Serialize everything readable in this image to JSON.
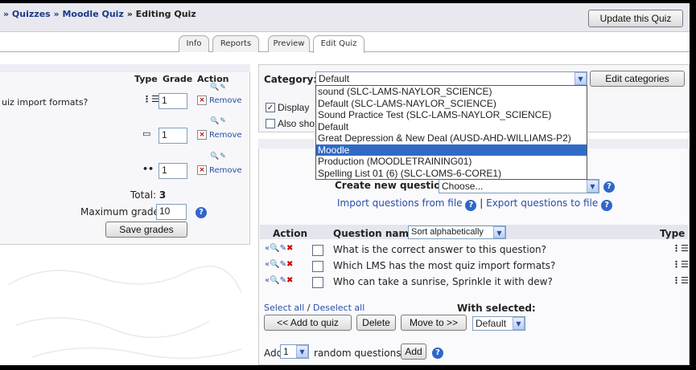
{
  "navbar": {
    "breadcrumb_quizzes": "» Quizzes",
    "breadcrumb_quiz": "» Moodle Quiz",
    "breadcrumb_current": "» Editing Quiz",
    "update_button": "Update this Quiz"
  },
  "tabs": [
    {
      "label": "Info"
    },
    {
      "label": "Reports"
    },
    {
      "label": "Preview"
    },
    {
      "label": "Edit Quiz"
    }
  ],
  "left": {
    "col_type": "Type",
    "col_grade": "Grade",
    "col_action": "Action",
    "rows": [
      {
        "text": "uiz import formats?",
        "grade": "1",
        "remove": "Remove"
      },
      {
        "text": "",
        "grade": "1",
        "remove": "Remove"
      },
      {
        "text": "",
        "grade": "1",
        "remove": "Remove"
      }
    ],
    "total_label": "Total:",
    "total_value": "3",
    "max_grade_label": "Maximum grade:",
    "max_grade_value": "10",
    "save_grades": "Save grades"
  },
  "category": {
    "label": "Category:",
    "selected": "Default",
    "edit_button": "Edit categories",
    "options": [
      {
        "label": "sound (SLC-LAMS-NAYLOR_SCIENCE)"
      },
      {
        "label": "Default (SLC-LAMS-NAYLOR_SCIENCE)"
      },
      {
        "label": "Sound Practice Test (SLC-LAMS-NAYLOR_SCIENCE)"
      },
      {
        "label": "Default"
      },
      {
        "label": "Great Depression & New Deal (AUSD-AHD-WILLIAMS-P2)"
      },
      {
        "label": "Moodle"
      },
      {
        "label": "Production (MOODLETRAINING01)"
      },
      {
        "label": "Spelling List 01 (6) (SLC-LOMS-6-CORE1)"
      }
    ],
    "highlighted_option": "Moodle",
    "display_checkbox_label": "Display",
    "also_checkbox_label": "Also sho"
  },
  "create": {
    "label": "Create new question:",
    "select_value": "Choose...",
    "import_link": "Import questions from file",
    "separator": "|",
    "export_link": "Export questions to file"
  },
  "question_table": {
    "col_action": "Action",
    "col_name": "Question name",
    "sort_value": "Sort alphabetically",
    "col_type": "Type",
    "rows": [
      {
        "name": "What is the correct answer to this question?"
      },
      {
        "name": "Which LMS has the most quiz import formats?"
      },
      {
        "name": "Who can take a sunrise, Sprinkle it with dew?"
      }
    ]
  },
  "bulk": {
    "select_all": "Select all",
    "slash": " / ",
    "deselect_all": "Deselect all",
    "with_selected": "With selected:",
    "add_to_quiz": "<< Add to quiz",
    "delete": "Delete",
    "move_to": "Move to >>",
    "move_target": "Default"
  },
  "random": {
    "add_label": "Add",
    "count": "1",
    "suffix": "random questions",
    "add_button": "Add"
  },
  "icons": {
    "help": "help-icon",
    "dropdown": "chevron-down-icon"
  },
  "colors": {
    "link": "#2a4fa6",
    "selection": "#316ac5"
  }
}
